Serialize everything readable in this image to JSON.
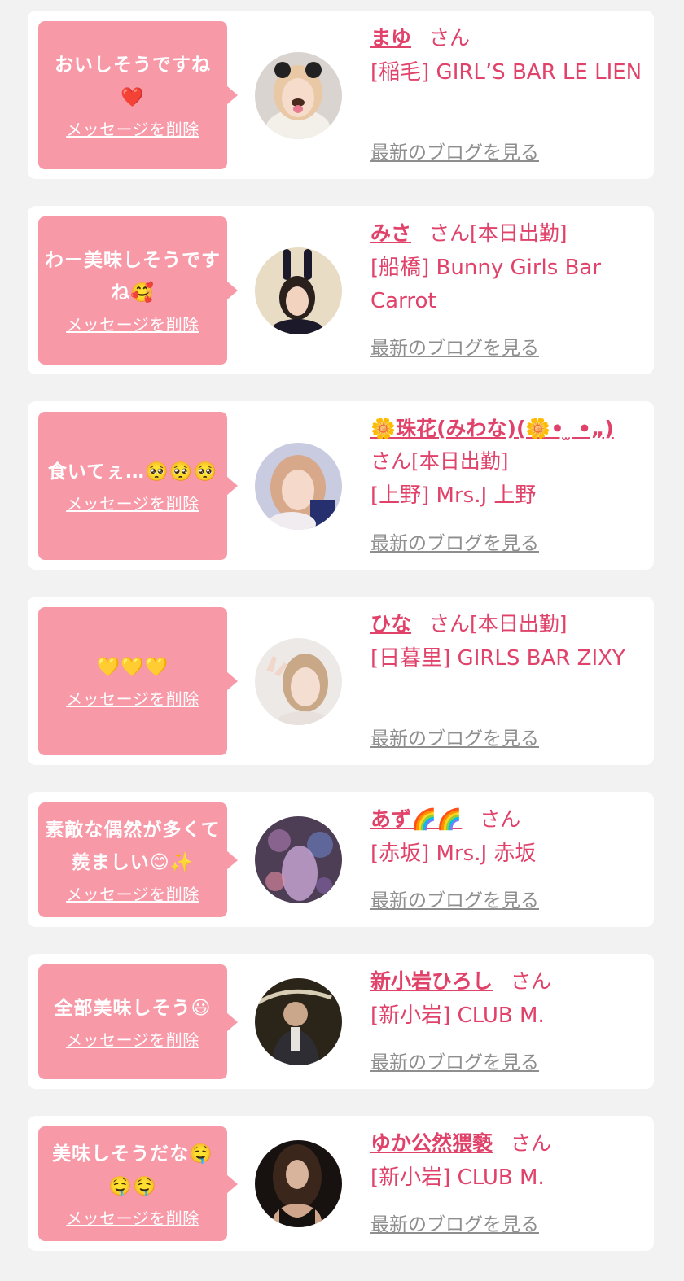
{
  "delete_label": "メッセージを削除",
  "san_label": "さん",
  "blog_label": "最新のブログを見る",
  "colors": {
    "background": "#f2f2f2",
    "card": "#ffffff",
    "bubble": "#f899a8",
    "accent": "#e0426a",
    "link_gray": "#8e8e8e"
  },
  "messages": [
    {
      "text": "おいしそうですね❤️",
      "name": "まゆ",
      "suffix": "",
      "shop": "[稲毛] GIRL’S BAR LE LIEN",
      "avatar_icon": "girl-with-dog-filter-photo"
    },
    {
      "text": "わー美味しそうですね🥰",
      "name": "みさ",
      "suffix": "[本日出勤]",
      "shop": "[船橋] Bunny Girls Bar Carrot",
      "avatar_icon": "bunny-ears-girl-photo"
    },
    {
      "text": "食いてぇ…🥺🥺🥺",
      "name": "🌼珠花(みわな)(🌼• ̫ •„)",
      "suffix": "[本日出勤]",
      "shop": "[上野] Mrs.J 上野",
      "avatar_icon": "girl-blonde-photo"
    },
    {
      "text": "💛💛💛",
      "name": "ひな",
      "suffix": "[本日出勤]",
      "shop": "[日暮里] GIRLS BAR ZIXY",
      "avatar_icon": "girl-peace-sign-photo"
    },
    {
      "text": "素敵な偶然が多くて羨ましい😊✨",
      "name": "あず🌈🌈",
      "suffix": "",
      "shop": "[赤坂] Mrs.J 赤坂",
      "avatar_icon": "blurred-bar-photo"
    },
    {
      "text": "全部美味しそう😃",
      "name": "新小岩ひろし",
      "suffix": "",
      "shop": "[新小岩] CLUB M.",
      "avatar_icon": "man-in-suit-photo"
    },
    {
      "text": "美味しそうだな🤤🤤🤤",
      "name": "ゆか公然猥褻",
      "suffix": "",
      "shop": "[新小岩] CLUB M.",
      "avatar_icon": "woman-dark-hair-photo"
    }
  ]
}
